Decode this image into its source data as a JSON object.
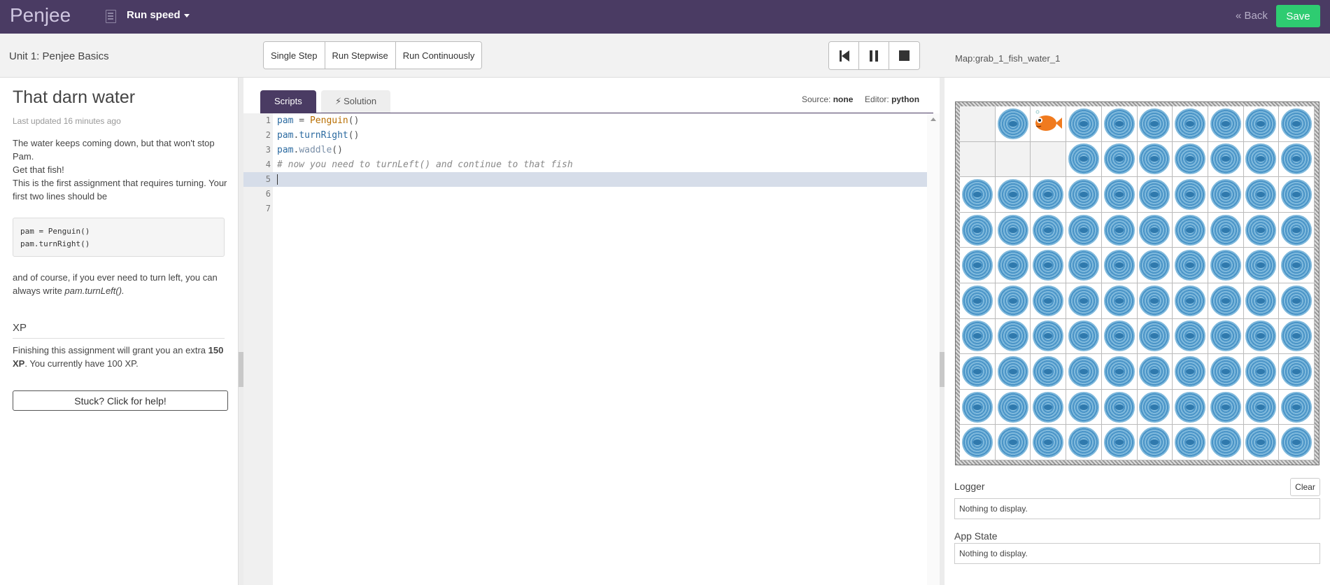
{
  "topbar": {
    "brand": "Penjee",
    "run_speed": "Run speed",
    "back": "« Back",
    "save": "Save"
  },
  "subbar": {
    "unit_title": "Unit 1: Penjee Basics",
    "run_buttons": [
      "Single Step",
      "Run Stepwise",
      "Run Continuously"
    ],
    "map_name": "Map:grab_1_fish_water_1"
  },
  "lesson": {
    "title": "That darn water",
    "updated": "Last updated 16 minutes ago",
    "desc_lines": [
      "The water keeps coming down, but that won't stop Pam.",
      "Get that fish!",
      "This is the first assignment that requires turning. Your first two lines should be"
    ],
    "code_lines": [
      "pam = Penguin()",
      "pam.turnRight()"
    ],
    "after_text": "and of course, if you ever need to turn left, you can always write ",
    "after_code": "pam.turnLeft().",
    "xp_heading": "XP",
    "xp_text_1": "Finishing this assignment will grant you an extra ",
    "xp_amount": "150 XP",
    "xp_text_2": ". You currently have 100 XP.",
    "help_button": "Stuck? Click for help!"
  },
  "editor": {
    "tabs": [
      "Scripts",
      "Solution"
    ],
    "source_label": "Source:",
    "source_value": "none",
    "editor_label": "Editor:",
    "editor_value": "python",
    "line_numbers": [
      "1",
      "2",
      "3",
      "4",
      "5",
      "6",
      "7"
    ],
    "line1": {
      "a": "pam",
      "b": " = ",
      "c": "Penguin",
      "d": "()"
    },
    "line2": {
      "a": "pam",
      "b": ".",
      "c": "turnRight",
      "d": "()"
    },
    "line3": {
      "a": "pam",
      "b": ".",
      "c": "waddle",
      "d": "()"
    },
    "line4": "# now you need to turnLeft() and continue to that fish",
    "active_line": 5
  },
  "world": {
    "rows": 10,
    "cols": 10,
    "empty_cells": [
      [
        0,
        0
      ],
      [
        1,
        0
      ],
      [
        1,
        1
      ],
      [
        1,
        2
      ]
    ],
    "fish_cell": [
      0,
      2
    ],
    "colors": {
      "water_light": "#7fb9dc",
      "water_dark": "#4a94c7",
      "fish": "#f07a1e"
    }
  },
  "logger": {
    "label": "Logger",
    "clear": "Clear",
    "content": "Nothing to display."
  },
  "app_state": {
    "label": "App State",
    "content": "Nothing to display."
  }
}
